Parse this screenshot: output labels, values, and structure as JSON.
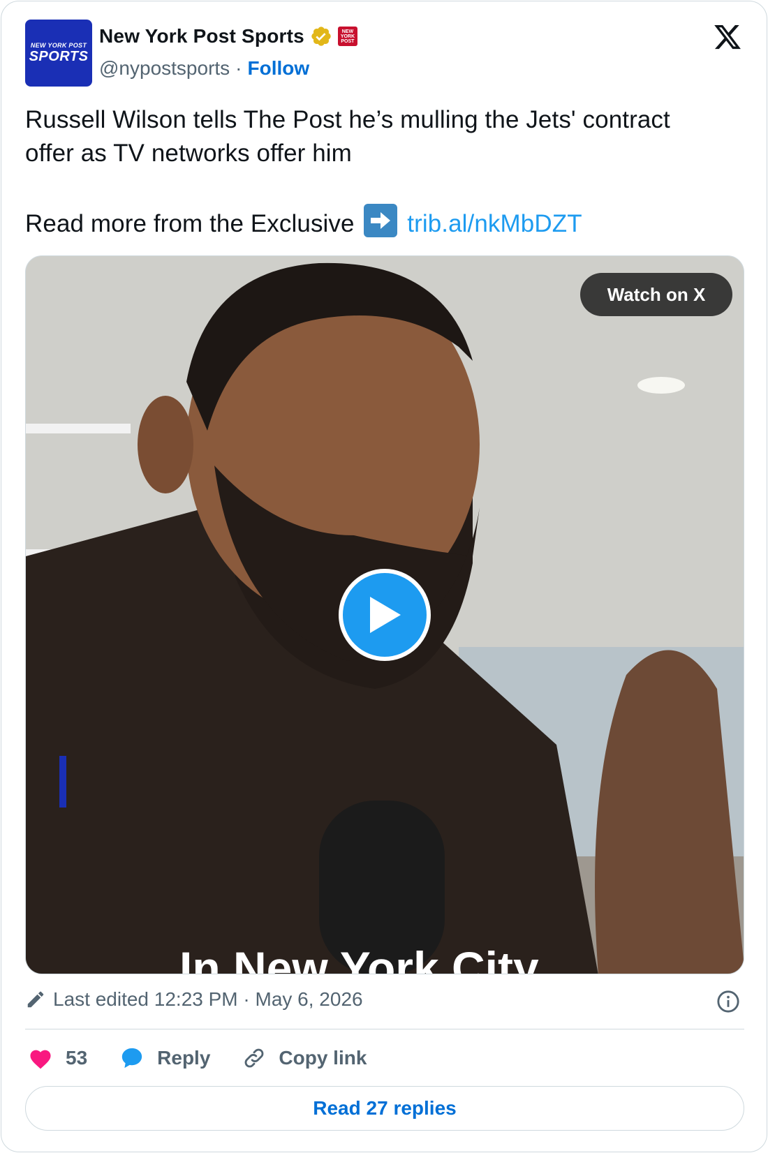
{
  "account": {
    "display_name": "New York Post Sports",
    "handle": "@nypostsports",
    "separator": "·",
    "follow_label": "Follow",
    "avatar_small": "NEW YORK POST",
    "avatar_big": "SPORTS",
    "affiliate_badge": "NEW YORK POST"
  },
  "tweet": {
    "line1": "Russell Wilson tells The Post he’s mulling the Jets' contract",
    "line2": "offer as TV networks offer him",
    "line3_prefix": "Read more from the Exclusive",
    "link": "trib.al/nkMbDZT"
  },
  "media": {
    "watch_label": "Watch on X",
    "caption": "In New York City"
  },
  "meta": {
    "edited_text": "Last edited 12:23 PM · May 6, 2026"
  },
  "actions": {
    "likes_count": "53",
    "reply_label": "Reply",
    "copy_label": "Copy link"
  },
  "footer": {
    "read_replies": "Read 27 replies"
  },
  "colors": {
    "link": "#1d9bf0",
    "follow": "#006fd6",
    "heart": "#f91880",
    "verified": "#e2b719"
  }
}
